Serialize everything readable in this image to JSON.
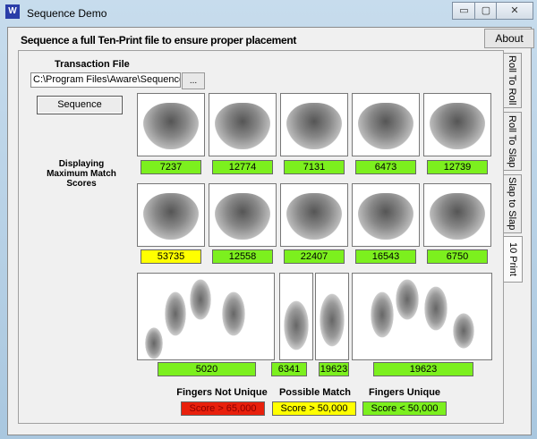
{
  "window": {
    "title": "Sequence Demo",
    "minimize": "▭",
    "maximize": "▢",
    "close": "✕"
  },
  "header": {
    "text": "Sequence a full Ten-Print file to ensure proper placement",
    "about": "About"
  },
  "tabs": [
    "Roll To Roll",
    "Roll To Slap",
    "Slap to Slap",
    "10 Print"
  ],
  "transaction": {
    "label": "Transaction File",
    "value": "C:\\Program Files\\Aware\\Sequence",
    "browse": "...",
    "sequence": "Sequence"
  },
  "display_label": "Displaying Maximum Match Scores",
  "row1": [
    "7237",
    "12774",
    "7131",
    "6473",
    "12739"
  ],
  "row2": [
    "53735",
    "12558",
    "22407",
    "16543",
    "6750"
  ],
  "row3": [
    "5020",
    "6341",
    "19623",
    "19623"
  ],
  "legend": [
    {
      "title": "Fingers Not Unique",
      "box": "Score > 65,000",
      "color": "#e8200c"
    },
    {
      "title": "Possible Match",
      "box": "Score > 50,000",
      "color": "#ffff00"
    },
    {
      "title": "Fingers Unique",
      "box": "Score < 50,000",
      "color": "#7cf01e"
    }
  ],
  "colors": {
    "unique": "#7cf01e",
    "possible": "#ffff00",
    "not_unique": "#e8200c"
  }
}
